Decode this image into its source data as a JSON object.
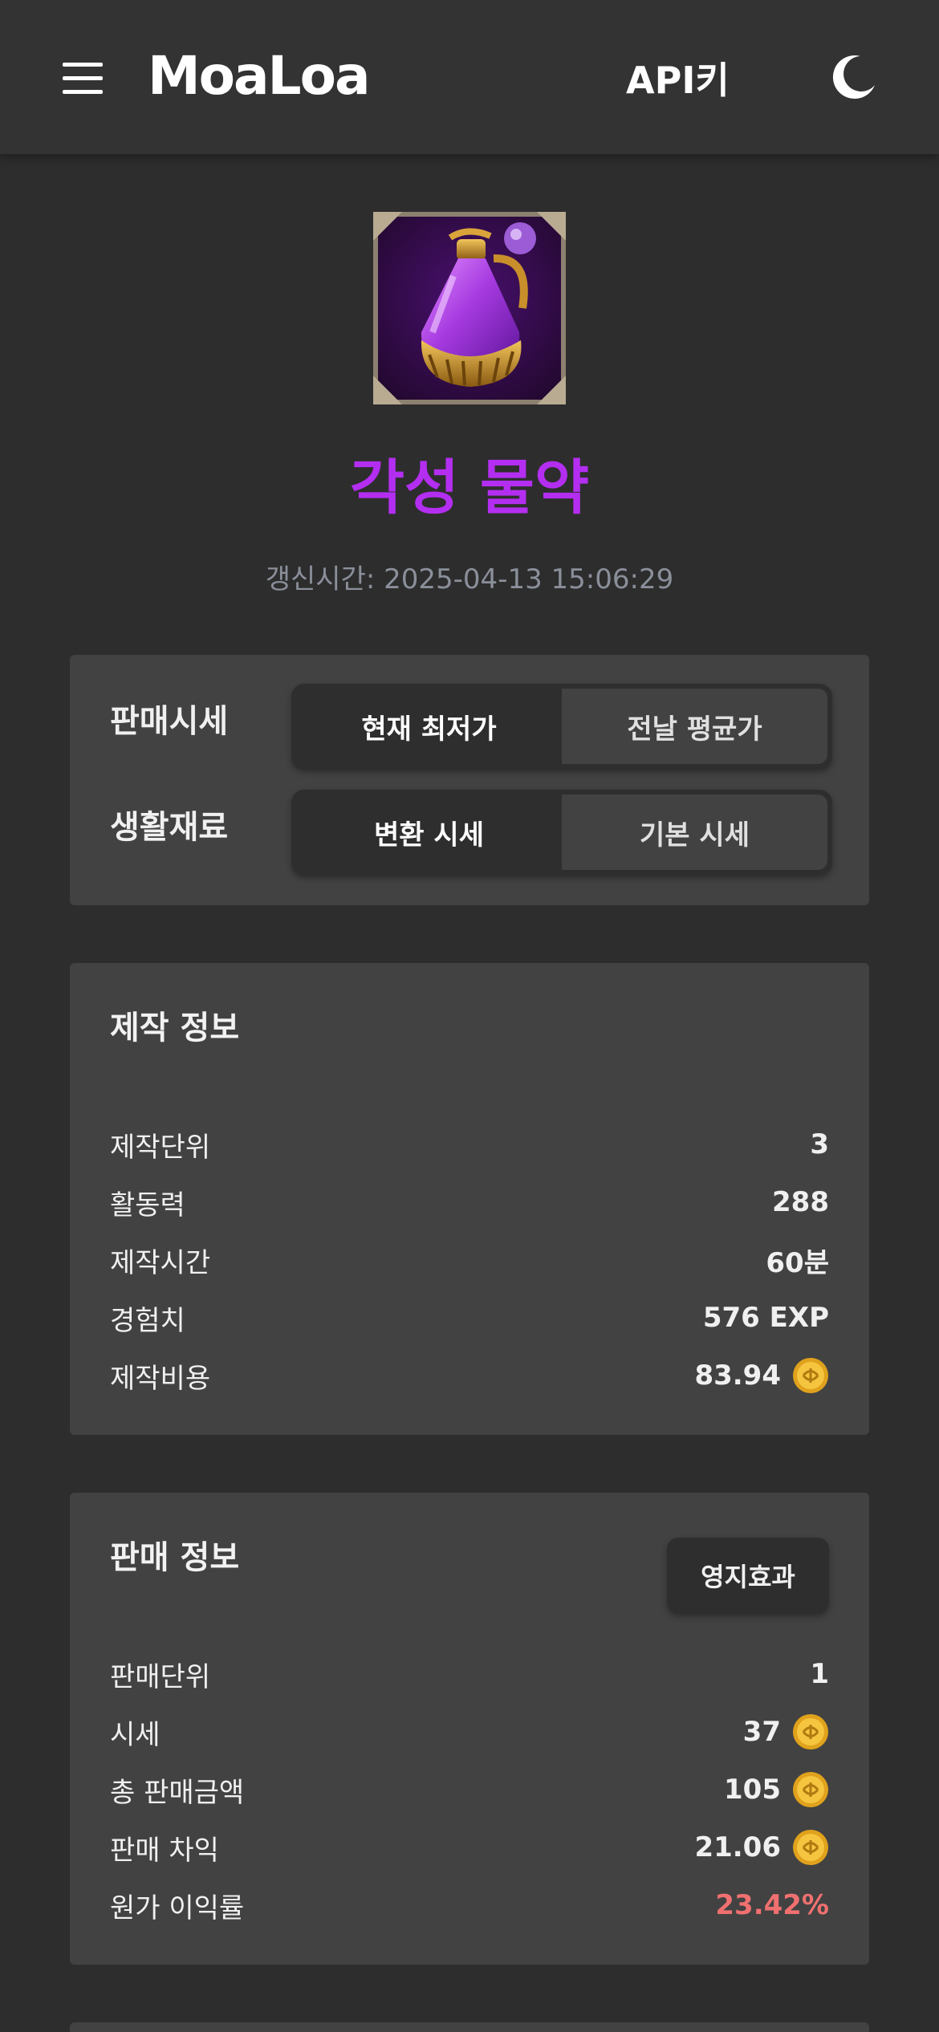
{
  "header": {
    "logo": "MoaLoa",
    "api_key_label": "API키",
    "menu_icon": "hamburger-menu-icon",
    "theme_icon": "moon-icon"
  },
  "item": {
    "name": "각성 물약",
    "name_color": "#b32ef0",
    "update_time": "갱신시간: 2025-04-13 15:06:29"
  },
  "price_options": {
    "sale_label": "판매시세",
    "sale_options": [
      "현재 최저가",
      "전날 평균가"
    ],
    "sale_selected": "현재 최저가",
    "material_label": "생활재료",
    "material_options": [
      "변환 시세",
      "기본 시세"
    ],
    "material_selected": "변환 시세"
  },
  "craft_info": {
    "title": "제작 정보",
    "rows": [
      {
        "label": "제작단위",
        "value": "3"
      },
      {
        "label": "활동력",
        "value": "288"
      },
      {
        "label": "제작시간",
        "value": "60분"
      },
      {
        "label": "경험치",
        "value": "576 EXP"
      },
      {
        "label": "제작비용",
        "value": "83.94",
        "gold": true
      }
    ]
  },
  "sale_info": {
    "title": "판매 정보",
    "territory_button": "영지효과",
    "rows": [
      {
        "label": "판매단위",
        "value": "1"
      },
      {
        "label": "시세",
        "value": "37",
        "gold": true
      },
      {
        "label": "총 판매금액",
        "value": "105",
        "gold": true
      },
      {
        "label": "판매 차익",
        "value": "21.06",
        "gold": true
      },
      {
        "label": "원가 이익률",
        "value": "23.42%",
        "highlight_color": "#f07070"
      }
    ]
  }
}
